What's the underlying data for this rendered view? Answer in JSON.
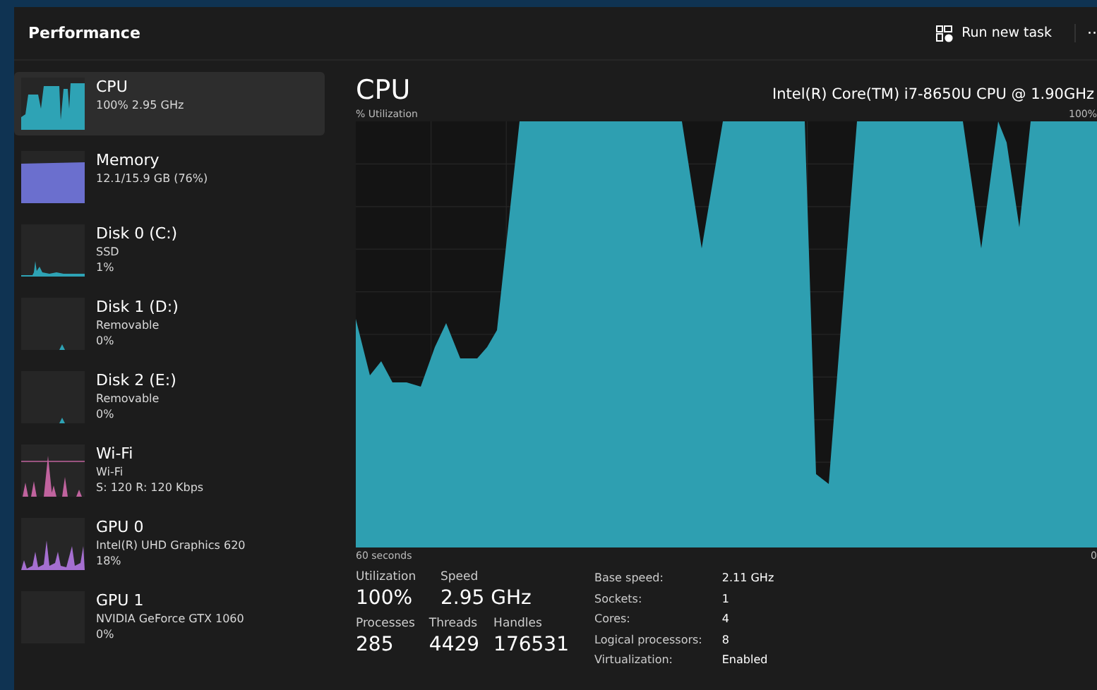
{
  "header": {
    "title": "Performance",
    "run_task": "Run new task",
    "more": "··"
  },
  "sidebar": {
    "items": [
      {
        "kind": "cpu",
        "name": "CPU",
        "lines": [
          "100%  2.95 GHz"
        ],
        "color": "#2ea3b5",
        "selected": true
      },
      {
        "kind": "memory",
        "name": "Memory",
        "lines": [
          "12.1/15.9 GB (76%)"
        ],
        "color": "#6b6fce",
        "selected": false
      },
      {
        "kind": "disk",
        "name": "Disk 0 (C:)",
        "lines": [
          "SSD",
          "1%"
        ],
        "color": "#2ea3b5",
        "selected": false
      },
      {
        "kind": "flat",
        "name": "Disk 1 (D:)",
        "lines": [
          "Removable",
          "0%"
        ],
        "color": "#2ea3b5",
        "selected": false
      },
      {
        "kind": "flat",
        "name": "Disk 2 (E:)",
        "lines": [
          "Removable",
          "0%"
        ],
        "color": "#2ea3b5",
        "selected": false
      },
      {
        "kind": "wifi",
        "name": "Wi-Fi",
        "lines": [
          "Wi-Fi",
          "S: 120  R: 120 Kbps"
        ],
        "color": "#c0639e",
        "selected": false
      },
      {
        "kind": "gpu",
        "name": "GPU 0",
        "lines": [
          "Intel(R) UHD Graphics 620",
          "18%"
        ],
        "color": "#a56fd0",
        "selected": false
      },
      {
        "kind": "empty",
        "name": "GPU 1",
        "lines": [
          "NVIDIA GeForce GTX 1060",
          "0%"
        ],
        "selected": false
      }
    ]
  },
  "main": {
    "title": "CPU",
    "model": "Intel(R) Core(TM) i7-8650U CPU @ 1.90GHz",
    "y_label": "% Utilization",
    "y_max": "100%",
    "x_label": "60 seconds",
    "x_end": "0",
    "stats": [
      {
        "label": "Utilization",
        "value": "100%"
      },
      {
        "label": "Speed",
        "value": "2.95 GHz"
      }
    ],
    "counts": [
      {
        "label": "Processes",
        "value": "285"
      },
      {
        "label": "Threads",
        "value": "4429"
      },
      {
        "label": "Handles",
        "value": "176531"
      }
    ],
    "details": [
      {
        "label": "Base speed:",
        "value": "2.11 GHz"
      },
      {
        "label": "Sockets:",
        "value": "1"
      },
      {
        "label": "Cores:",
        "value": "4"
      },
      {
        "label": "Logical processors:",
        "value": "8"
      },
      {
        "label": "Virtualization:",
        "value": "Enabled"
      }
    ]
  }
}
